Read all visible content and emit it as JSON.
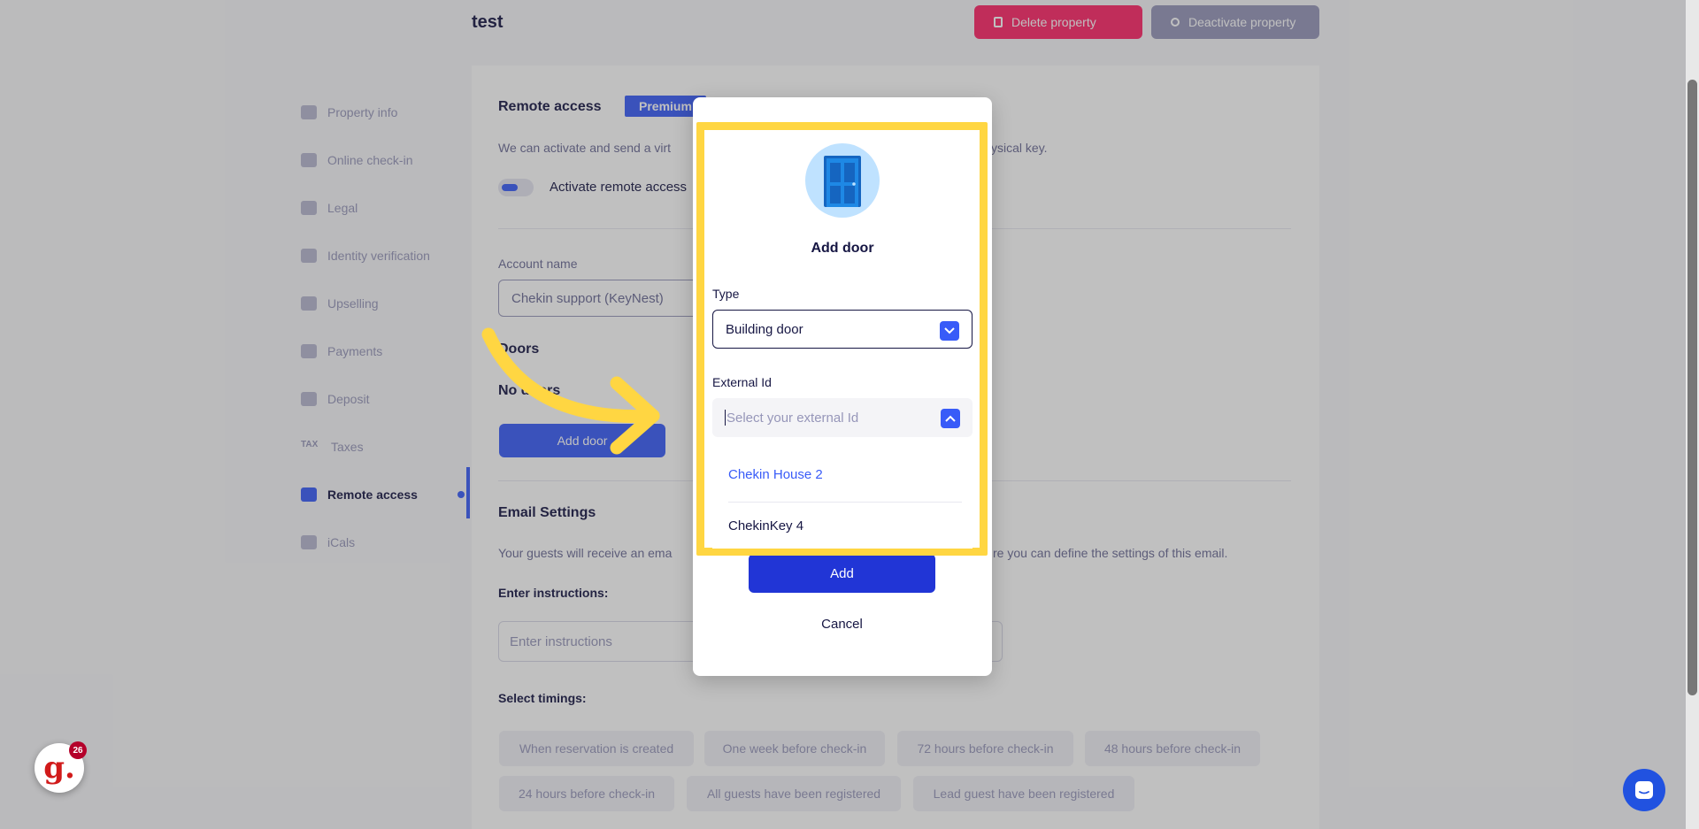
{
  "header": {
    "property_title": "test",
    "delete_label": "Delete property",
    "deactivate_label": "Deactivate property"
  },
  "sidebar": {
    "items": [
      {
        "label": "Property info",
        "icon": "building-icon"
      },
      {
        "label": "Online check-in",
        "icon": "user-check-icon"
      },
      {
        "label": "Legal",
        "icon": "legal-icon"
      },
      {
        "label": "Identity verification",
        "icon": "id-card-icon"
      },
      {
        "label": "Upselling",
        "icon": "upselling-icon"
      },
      {
        "label": "Payments",
        "icon": "payments-icon"
      },
      {
        "label": "Deposit",
        "icon": "deposit-icon"
      },
      {
        "label": "Taxes",
        "icon": "tax-icon",
        "icon_text": "TAX"
      },
      {
        "label": "Remote access",
        "icon": "key-icon"
      },
      {
        "label": "iCals",
        "icon": "calendar-icon"
      }
    ],
    "active_item": "Remote access"
  },
  "main": {
    "remote_access_title": "Remote access",
    "premium_badge": "Premium",
    "remote_desc_left": "We can activate and send a virt",
    "remote_desc_right": "he physical key.",
    "toggle_label": "Activate remote access",
    "account_name_label": "Account name",
    "account_name_value": "Chekin support (KeyNest)",
    "doors_title": "Doors",
    "no_doors_text": "No doors",
    "add_door_button": "Add door",
    "email_settings_title": "Email Settings",
    "email_desc_left": "Your guests will receive an ema",
    "email_desc_right": "re you can define the settings of this email.",
    "instructions_label": "Enter instructions:",
    "instructions_placeholder": "Enter instructions",
    "timings_label": "Select timings:",
    "timings": [
      "When reservation is created",
      "One week before check-in",
      "72 hours before check-in",
      "48 hours before check-in",
      "24 hours before check-in",
      "All guests have been registered",
      "Lead guest have been registered"
    ]
  },
  "modal": {
    "title": "Add door",
    "type_label": "Type",
    "type_value": "Building door",
    "external_id_label": "External Id",
    "external_id_placeholder": "Select your external Id",
    "options": [
      "Chekin House 2",
      "ChekinKey 4"
    ],
    "add_button": "Add",
    "cancel_button": "Cancel"
  },
  "widgets": {
    "g_logo": "g.",
    "g_badge_count": "26"
  },
  "colors": {
    "accent": "#385bf8",
    "highlight": "#ffd642",
    "delete": "#ff2467",
    "text_dark": "#161643"
  }
}
